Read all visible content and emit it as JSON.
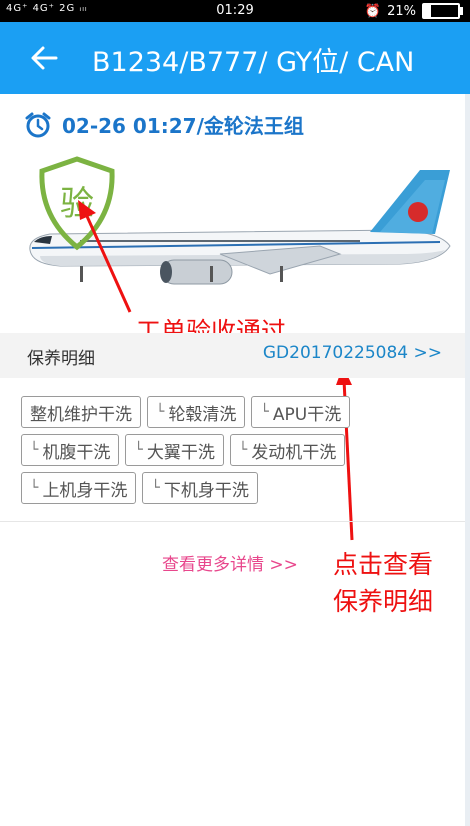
{
  "status_bar": {
    "signal": "4G⁺ 4G⁺ 2G ᵢₗₗ",
    "time": "01:29",
    "battery": "21%"
  },
  "header": {
    "title": "B1234/B777/ GY位/ CAN"
  },
  "flight": {
    "time_text": "02-26 01:27/金轮法王组"
  },
  "badge": {
    "text": "验"
  },
  "annotations": {
    "approved": "工单验收通过",
    "view_line1": "点击查看",
    "view_line2": "保养明细"
  },
  "maintenance": {
    "label": "保养明细",
    "work_order": "GD20170225084 >>"
  },
  "tags": [
    [
      "整机维护干洗",
      "轮毂清洗",
      "APU干洗"
    ],
    [
      "机腹干洗",
      "大翼干洗",
      "发动机干洗"
    ],
    [
      "上机身干洗",
      "下机身干洗"
    ]
  ],
  "tag_marks": [
    [
      false,
      true,
      true
    ],
    [
      true,
      true,
      true
    ],
    [
      true,
      true
    ]
  ],
  "more": {
    "label": "查看更多详情 >>"
  },
  "colors": {
    "header": "#1b9ff3",
    "accent": "#1b75c9",
    "annotation": "#e11111",
    "more": "#e8478c",
    "badge": "#7cb342"
  }
}
